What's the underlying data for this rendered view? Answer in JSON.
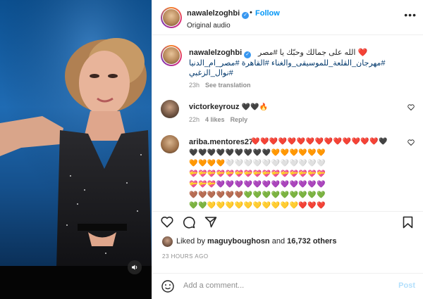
{
  "header": {
    "username": "nawalelzoghbi",
    "follow_label": "Follow",
    "separator": "•",
    "subtitle": "Original audio",
    "more": "•••"
  },
  "caption": {
    "username": "nawalelzoghbi",
    "line1": "❤️ الله على جمالك وحبّك يا #مصر",
    "line2": "#مهرجان_القلعة_للموسيقى_والغناء #القاهرة #مصر_ام_الدنيا",
    "line3": "#نوال_الزغبي",
    "time": "23h",
    "translate": "See translation"
  },
  "comments": [
    {
      "username": "victorkeyrouz",
      "text": "🖤🖤🔥",
      "time": "22h",
      "likes": "4 likes",
      "reply": "Reply"
    },
    {
      "username": "ariba.mentores27",
      "rows": [
        "❤️❤️❤️❤️❤️❤️❤️❤️❤️❤️❤️❤️❤️❤️🖤",
        "🖤🖤🖤🖤🖤🖤🖤🖤🖤🧡🧡🧡🧡🧡🧡",
        "🧡🧡🧡🧡🤍🤍🤍🤍🤍🤍🤍🤍🤍🤍🤍",
        "💝💝💝💝💝💝💝💝💝💝💝💝💝💝💝",
        "💝💝💝💜💜💜💜💜💜💜💜💜💜💜💜",
        "🤎🤎🤎🤎🤎🤎💚💚💚💚💚💚💚💚💚",
        "💚💚💛💛💛💛💛💛💛💛💛💛❤️❤️❤️"
      ]
    }
  ],
  "likes": {
    "prefix": "Liked by",
    "user": "maguyboughosn",
    "and": "and",
    "count": "16,732 others"
  },
  "timestamp": "23 HOURS AGO",
  "add_comment": {
    "placeholder": "Add a comment...",
    "post": "Post"
  },
  "icons": [
    "volume-icon",
    "heart-icon",
    "comment-icon",
    "share-icon",
    "bookmark-icon",
    "emoji-icon"
  ],
  "colors": {
    "link": "#0095f6",
    "hashtag": "#00376b",
    "muted": "#8e8e8e",
    "post_disabled": "#b2dffc"
  }
}
